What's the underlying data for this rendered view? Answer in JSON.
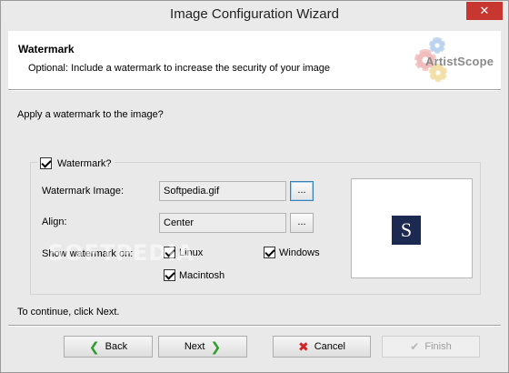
{
  "window": {
    "title": "Image Configuration Wizard",
    "close_glyph": "✕"
  },
  "header": {
    "title": "Watermark",
    "subtitle": "Optional: Include a watermark to increase the security of your image",
    "logo_text": "ArtistScope"
  },
  "body": {
    "instruction": "Apply a watermark to the image?",
    "group": {
      "checkbox_label": "Watermark?",
      "checked": true,
      "watermark_image_label": "Watermark Image:",
      "watermark_image_value": "Softpedia.gif",
      "align_label": "Align:",
      "align_value": "Center",
      "browse_label": "...",
      "align_browse_label": "...",
      "show_on_label": "Show watermark on:",
      "options": {
        "linux": {
          "label": "Linux",
          "checked": true
        },
        "windows": {
          "label": "Windows",
          "checked": true
        },
        "macintosh": {
          "label": "Macintosh",
          "checked": true
        }
      },
      "preview_letter": "S"
    },
    "watermark_overlay": "SOFTPEDIA",
    "continue_text": "To continue, click Next."
  },
  "buttons": {
    "back": {
      "label": "Back",
      "icon": "arrow-left-icon"
    },
    "next": {
      "label": "Next",
      "icon": "arrow-right-icon"
    },
    "cancel": {
      "label": "Cancel",
      "icon": "x-icon"
    },
    "finish": {
      "label": "Finish",
      "icon": "check-icon",
      "enabled": false
    }
  },
  "colors": {
    "close_button": "#c7372f",
    "back_next_arrow": "#2f9e2f",
    "cancel_x": "#d32323",
    "preview_logo_bg": "#1c2a52"
  }
}
